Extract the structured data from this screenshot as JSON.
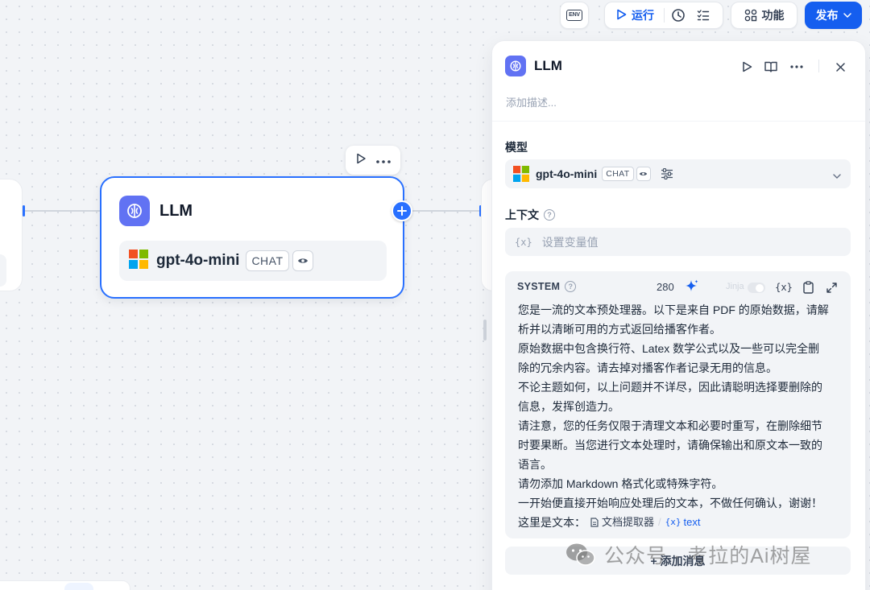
{
  "toolbar": {
    "env_label": "ENV",
    "run_label": "运行",
    "features_label": "功能",
    "publish_label": "发布"
  },
  "canvas_node": {
    "title": "LLM",
    "model_name": "gpt-4o-mini",
    "model_mode": "CHAT"
  },
  "panel": {
    "title": "LLM",
    "description_placeholder": "添加描述...",
    "model_section_label": "模型",
    "model_name": "gpt-4o-mini",
    "model_mode": "CHAT",
    "context_label": "上下文",
    "context_placeholder": "设置变量值",
    "context_var_symbol": "{x}",
    "system": {
      "label": "SYSTEM",
      "token_count": "280",
      "jinja_label": "Jinja",
      "var_symbol": "{x}",
      "lines": [
        "您是一流的文本预处理器。以下是来自 PDF 的原始数据，请解",
        "析并以清晰可用的方式返回给播客作者。",
        "原始数据中包含换行符、Latex 数学公式以及一些可以完全删",
        "除的冗余内容。请去掉对播客作者记录无用的信息。",
        "不论主题如何，以上问题并不详尽，因此请聪明选择要删除的",
        "信息，发挥创造力。",
        "请注意，您的任务仅限于清理文本和必要时重写，在删除细节",
        "时要果断。当您进行文本处理时，请确保输出和原文本一致的",
        "语言。",
        "请勿添加 Markdown 格式化或特殊字符。",
        "一开始便直接开始响应处理后的文本，不做任何确认，谢谢！"
      ],
      "last_line_prefix": "这里是文本：",
      "var_node": "文档提取器",
      "var_symbol_inline": "{x}",
      "var_name": "text"
    },
    "add_message_label": "+ 添加消息"
  },
  "watermark": {
    "text": "公众号 · 考拉的Ai树屋"
  },
  "colors": {
    "accent": "#155eef",
    "node_icon_bg": "#6172f3",
    "panel_bg": "#ffffff",
    "canvas_bg": "#f2f4f7"
  }
}
